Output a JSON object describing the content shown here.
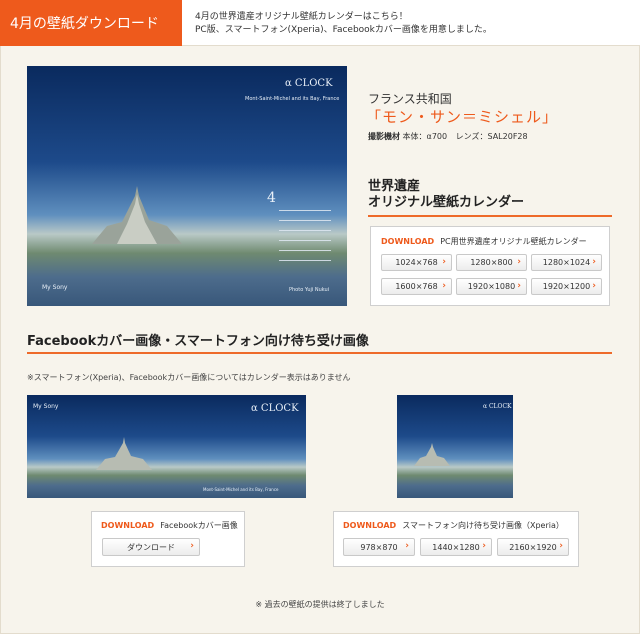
{
  "header": {
    "tab_label": "4月の壁紙ダウンロード",
    "desc_line1": "4月の世界遺産オリジナル壁紙カレンダーはこちら！",
    "desc_line2": "PC版、スマートフォン(Xperia)、Facebookカバー画像を用意しました。"
  },
  "wallpaper": {
    "brand": "α CLOCK",
    "location_caption": "Mont-Saint-Michel and its Bay, France",
    "month": "4",
    "mysony": "My Sony",
    "credit": "Photo Yuji Nukui"
  },
  "info": {
    "country": "フランス共和国",
    "place": "「モン・サン＝ミシェル」",
    "specs_label_camera": "撮影機材",
    "specs_body": "本体：α700",
    "specs_lens": "レンズ：SAL20F28"
  },
  "calendar": {
    "title_line1": "世界遺産",
    "title_line2": "オリジナル壁紙カレンダー",
    "download_label": "DOWNLOAD",
    "pc_heading": "PC用世界遺産オリジナル壁紙カレンダー",
    "pc_sizes": [
      "1024×768",
      "1280×800",
      "1280×1024",
      "1600×768",
      "1920×1080",
      "1920×1200"
    ]
  },
  "facebook_section": {
    "title": "Facebookカバー画像・スマートフォン向け待ち受け画像",
    "note": "※スマートフォン(Xperia)、Facebookカバー画像についてはカレンダー表示はありません",
    "fb_heading": "Facebookカバー画像",
    "fb_button": "ダウンロード",
    "sp_heading": "スマートフォン向け待ち受け画像（Xperia）",
    "sp_sizes": [
      "978×870",
      "1440×1280",
      "2160×1920"
    ]
  },
  "footer_note": "※ 過去の壁紙の提供は終了しました",
  "colors": {
    "accent": "#ee5a1c",
    "background": "#f7f4ec"
  }
}
